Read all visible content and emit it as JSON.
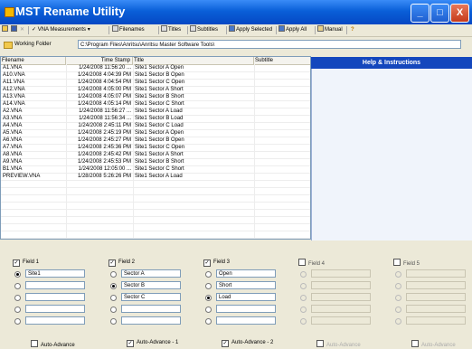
{
  "window": {
    "title": "MST Rename Utility",
    "minimize": "_",
    "maximize": "□",
    "close": "X"
  },
  "toolbar": {
    "vna_measurements": "VNA Measurements",
    "filenames": "Filenames",
    "titles": "Titles",
    "subtitles": "Subtitles",
    "apply_selected": "Apply Selected",
    "apply_all": "Apply All",
    "manual": "Manual",
    "help_glyph": "?"
  },
  "folder": {
    "label": "Working Folder",
    "path": "C:\\Program Files\\Anritsu\\Anritsu Master Software Tools\\"
  },
  "table": {
    "columns": [
      "Filename",
      "Time Stamp",
      "Title",
      "Subtitle"
    ],
    "rows": [
      [
        "A1.VNA",
        "1/24/2008 11:56:20 ...",
        "Site1 Sector A Open",
        ""
      ],
      [
        "A10.VNA",
        "1/24/2008 4:04:39 PM",
        "Site1 Sector B Open",
        ""
      ],
      [
        "A11.VNA",
        "1/24/2008 4:04:54 PM",
        "Site1 Sector C Open",
        ""
      ],
      [
        "A12.VNA",
        "1/24/2008 4:05:00 PM",
        "Site1 Sector A Short",
        ""
      ],
      [
        "A13.VNA",
        "1/24/2008 4:05:07 PM",
        "Site1 Sector B Short",
        ""
      ],
      [
        "A14.VNA",
        "1/24/2008 4:05:14 PM",
        "Site1 Sector C Short",
        ""
      ],
      [
        "A2.VNA",
        "1/24/2008 11:56:27 ...",
        "Site1 Sector A Load",
        ""
      ],
      [
        "A3.VNA",
        "1/24/2008 11:56:34 ...",
        "Site1 Sector B Load",
        ""
      ],
      [
        "A4.VNA",
        "1/24/2008 2:45:11 PM",
        "Site1 Sector C Load",
        ""
      ],
      [
        "A5.VNA",
        "1/24/2008 2:45:19 PM",
        "Site1 Sector A Open",
        ""
      ],
      [
        "A6.VNA",
        "1/24/2008 2:45:27 PM",
        "Site1 Sector B Open",
        ""
      ],
      [
        "A7.VNA",
        "1/24/2008 2:45:36 PM",
        "Site1 Sector C Open",
        ""
      ],
      [
        "A8.VNA",
        "1/24/2008 2:45:42 PM",
        "Site1 Sector A Short",
        ""
      ],
      [
        "A9.VNA",
        "1/24/2008 2:45:53 PM",
        "Site1 Sector B Short",
        ""
      ],
      [
        "B1.VNA",
        "1/24/2008 12:05:00 ...",
        "Site1 Sector C Short",
        ""
      ],
      [
        "PREVIEW.VNA",
        "1/28/2008 5:26:26 PM",
        "Site1 Sector A Load",
        ""
      ]
    ]
  },
  "help": {
    "title": "Help & Instructions"
  },
  "fields": [
    {
      "label": "Field 1",
      "checked": true,
      "values": [
        "Site1",
        "",
        "",
        "",
        ""
      ],
      "selected": 0,
      "auto": "Auto-Advance",
      "auto_checked": false,
      "enabled": true
    },
    {
      "label": "Field 2",
      "checked": true,
      "values": [
        "Sector A",
        "Sector B",
        "Sector C",
        "",
        ""
      ],
      "selected": 1,
      "auto": "Auto-Advance - 1",
      "auto_checked": true,
      "enabled": true
    },
    {
      "label": "Field 3",
      "checked": true,
      "values": [
        "Open",
        "Short",
        "Load",
        "",
        ""
      ],
      "selected": 2,
      "auto": "Auto-Advance - 2",
      "auto_checked": true,
      "enabled": true
    },
    {
      "label": "Field 4",
      "checked": false,
      "values": [
        "",
        "",
        "",
        "",
        ""
      ],
      "selected": -1,
      "auto": "Auto-Advance",
      "auto_checked": false,
      "enabled": false
    },
    {
      "label": "Field 5",
      "checked": false,
      "values": [
        "",
        "",
        "",
        "",
        ""
      ],
      "selected": -1,
      "auto": "Auto-Advance",
      "auto_checked": false,
      "enabled": false
    }
  ],
  "colors": {
    "titlebar": "#0a5fd8",
    "help_header": "#1447bd"
  }
}
